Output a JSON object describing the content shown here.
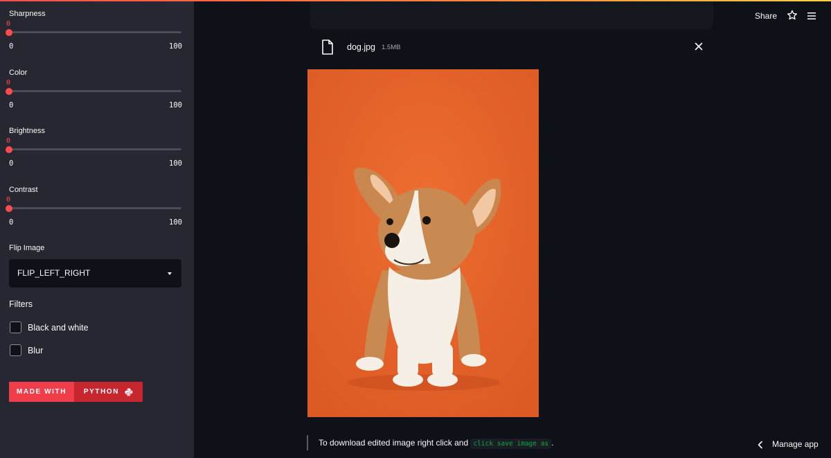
{
  "sidebar": {
    "sliders": [
      {
        "label": "Sharpness",
        "value": "0",
        "min": "0",
        "max": "100"
      },
      {
        "label": "Color",
        "value": "0",
        "min": "0",
        "max": "100"
      },
      {
        "label": "Brightness",
        "value": "0",
        "min": "0",
        "max": "100"
      },
      {
        "label": "Contrast",
        "value": "0",
        "min": "0",
        "max": "100"
      }
    ],
    "flip": {
      "label": "Flip Image",
      "selected": "FLIP_LEFT_RIGHT"
    },
    "filters": {
      "title": "Filters",
      "options": [
        {
          "label": "Black and white",
          "checked": false
        },
        {
          "label": "Blur",
          "checked": false
        }
      ]
    },
    "badge": {
      "left": "MADE WITH",
      "right": "PYTHON"
    }
  },
  "header": {
    "share": "Share"
  },
  "file": {
    "name": "dog.jpg",
    "size": "1.5MB"
  },
  "caption": {
    "text": "To download edited image right click and",
    "code": "click save image as",
    "tail": "."
  },
  "footer": {
    "manage": "Manage app"
  },
  "colors": {
    "accent": "#ff4b4b",
    "background": "#0e1117",
    "sidebar": "#262730",
    "photo_bg": "#e8652b"
  }
}
